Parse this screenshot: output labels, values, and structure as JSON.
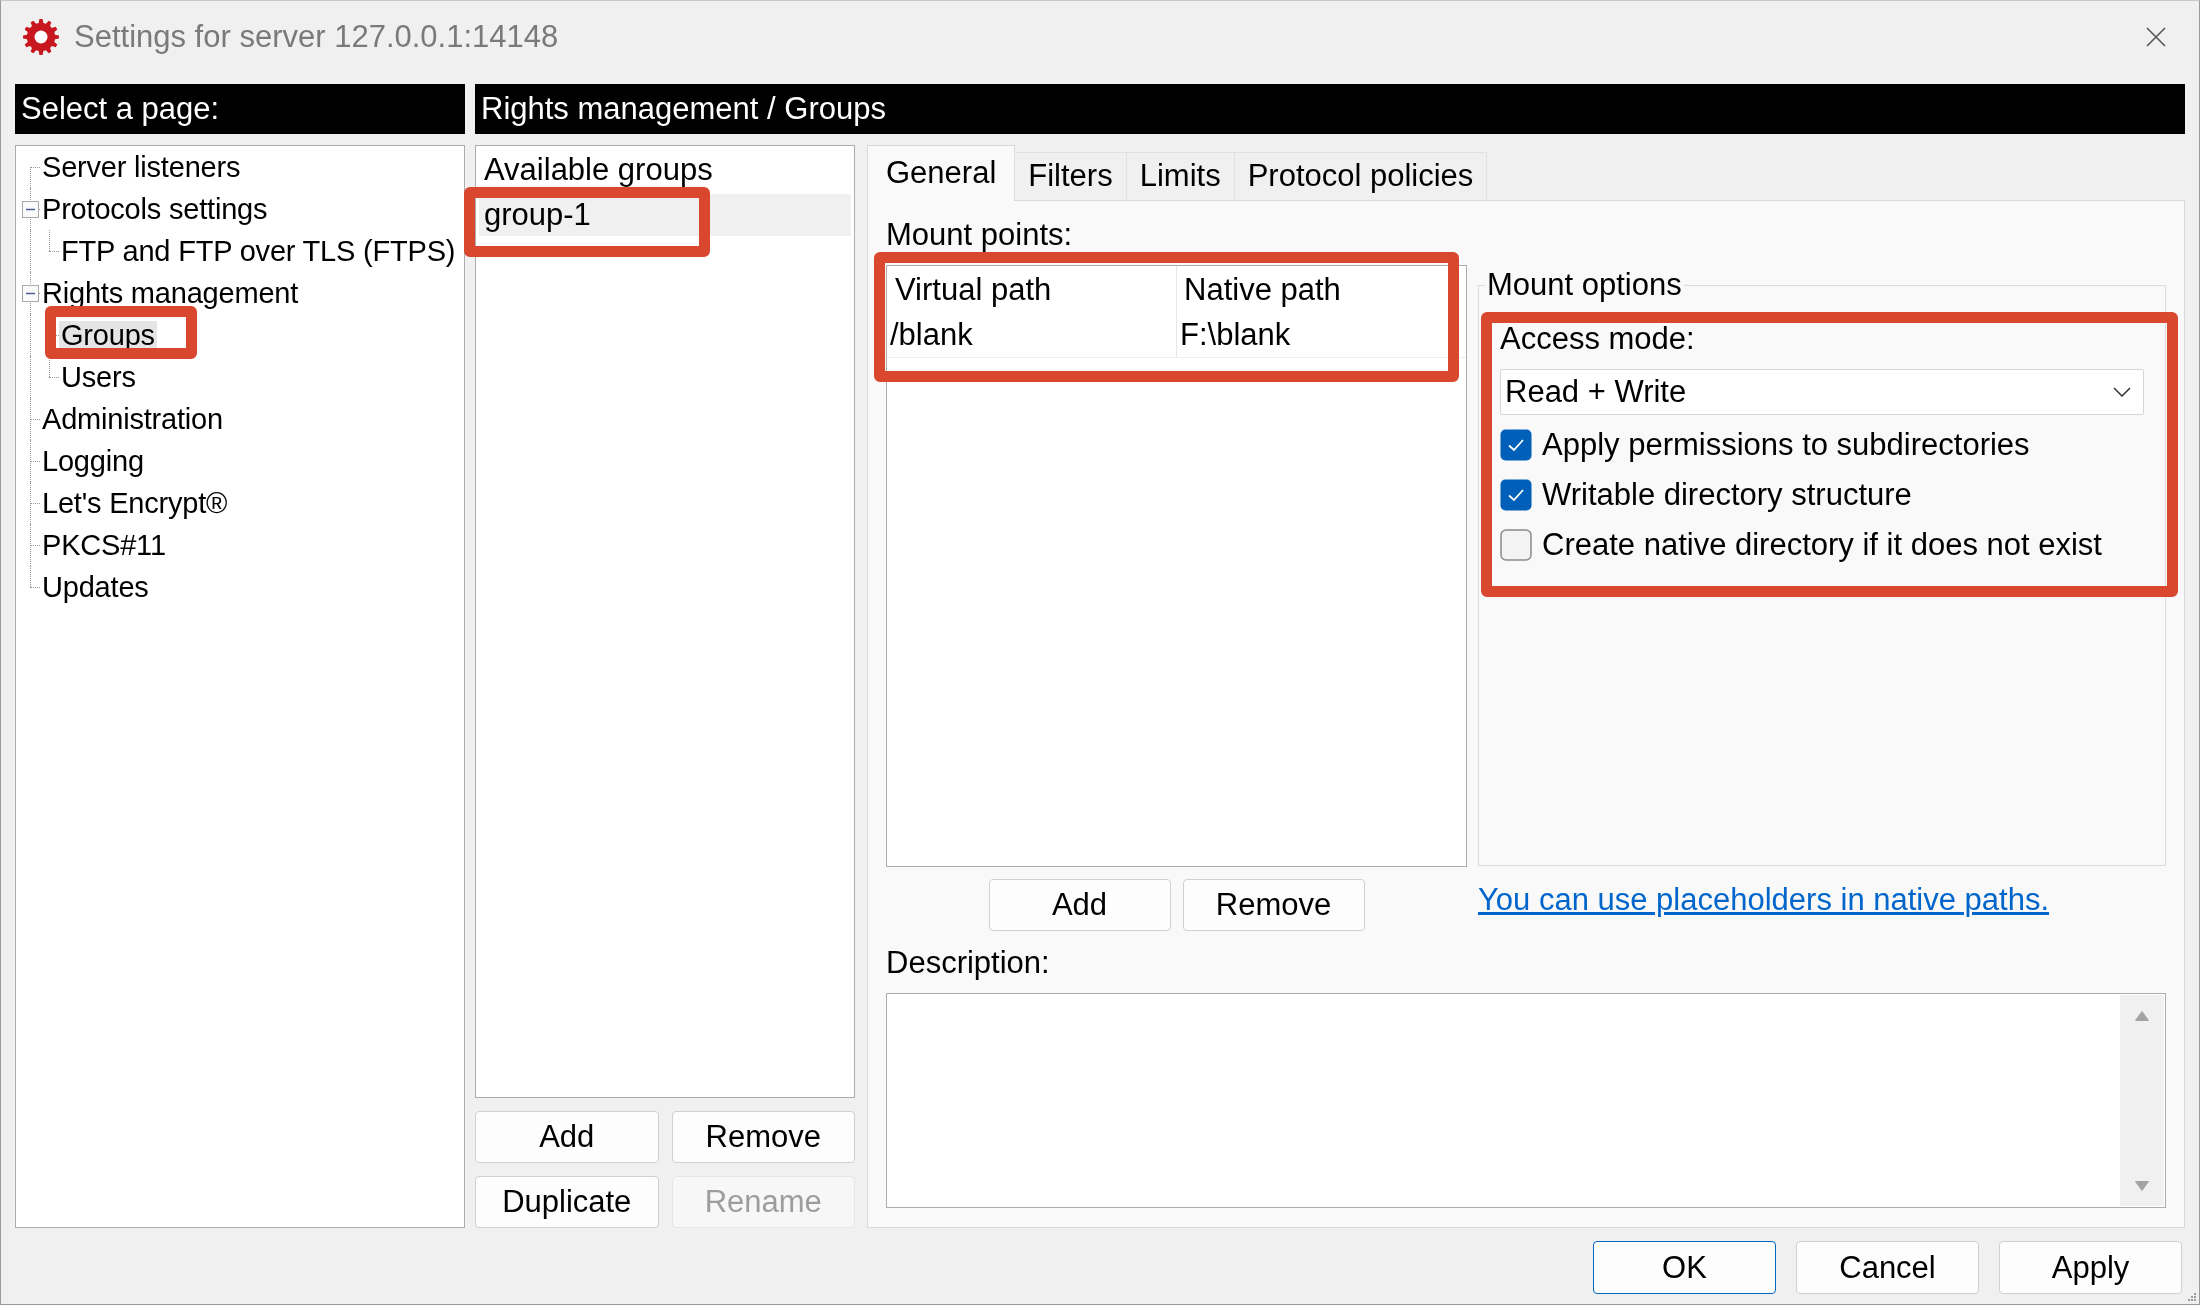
{
  "window": {
    "title": "Settings for server 127.0.0.1:14148"
  },
  "page_selector": {
    "heading": "Select a page:",
    "items": [
      {
        "label": "Server listeners",
        "selected": false,
        "highlighted": false
      },
      {
        "label": "Protocols settings",
        "selected": false,
        "highlighted": false,
        "expanded": true,
        "children": [
          {
            "label": "FTP and FTP over TLS (FTPS)",
            "selected": false,
            "highlighted": false
          }
        ]
      },
      {
        "label": "Rights management",
        "selected": false,
        "highlighted": false,
        "expanded": true,
        "children": [
          {
            "label": "Groups",
            "selected": true,
            "highlighted": true
          },
          {
            "label": "Users",
            "selected": false,
            "highlighted": false
          }
        ]
      },
      {
        "label": "Administration",
        "selected": false,
        "highlighted": false
      },
      {
        "label": "Logging",
        "selected": false,
        "highlighted": false
      },
      {
        "label": "Let's Encrypt®",
        "selected": false,
        "highlighted": false
      },
      {
        "label": "PKCS#11",
        "selected": false,
        "highlighted": false
      },
      {
        "label": "Updates",
        "selected": false,
        "highlighted": false
      }
    ]
  },
  "page_heading": "Rights management / Groups",
  "groups": {
    "heading": "Available groups",
    "items": [
      {
        "label": "group-1",
        "selected": true,
        "highlighted": true
      }
    ],
    "buttons": [
      {
        "label": "Add",
        "disabled": false
      },
      {
        "label": "Remove",
        "disabled": false
      },
      {
        "label": "Duplicate",
        "disabled": false
      },
      {
        "label": "Rename",
        "disabled": true
      }
    ]
  },
  "tabs": [
    {
      "label": "General",
      "selected": true
    },
    {
      "label": "Filters",
      "selected": false
    },
    {
      "label": "Limits",
      "selected": false
    },
    {
      "label": "Protocol policies",
      "selected": false
    }
  ],
  "general": {
    "mount_points": {
      "label": "Mount points:",
      "highlighted": true,
      "columns": [
        "Virtual path",
        "Native path"
      ],
      "rows": [
        [
          "/blank",
          "F:\\blank"
        ]
      ],
      "buttons": [
        "Add",
        "Remove"
      ]
    },
    "mount_options": {
      "title": "Mount options",
      "highlighted": true,
      "access_mode": {
        "label": "Access mode:",
        "value": "Read + Write"
      },
      "checkboxes": [
        {
          "label": "Apply permissions to subdirectories",
          "checked": true
        },
        {
          "label": "Writable directory structure",
          "checked": true
        },
        {
          "label": "Create native directory if it does not exist",
          "checked": false
        }
      ]
    },
    "placeholders_link": "You can use placeholders in native paths.",
    "description": {
      "label": "Description:"
    }
  },
  "dialog_buttons": [
    {
      "label": "OK",
      "default": true
    },
    {
      "label": "Cancel",
      "default": false
    },
    {
      "label": "Apply",
      "default": false
    }
  ]
}
